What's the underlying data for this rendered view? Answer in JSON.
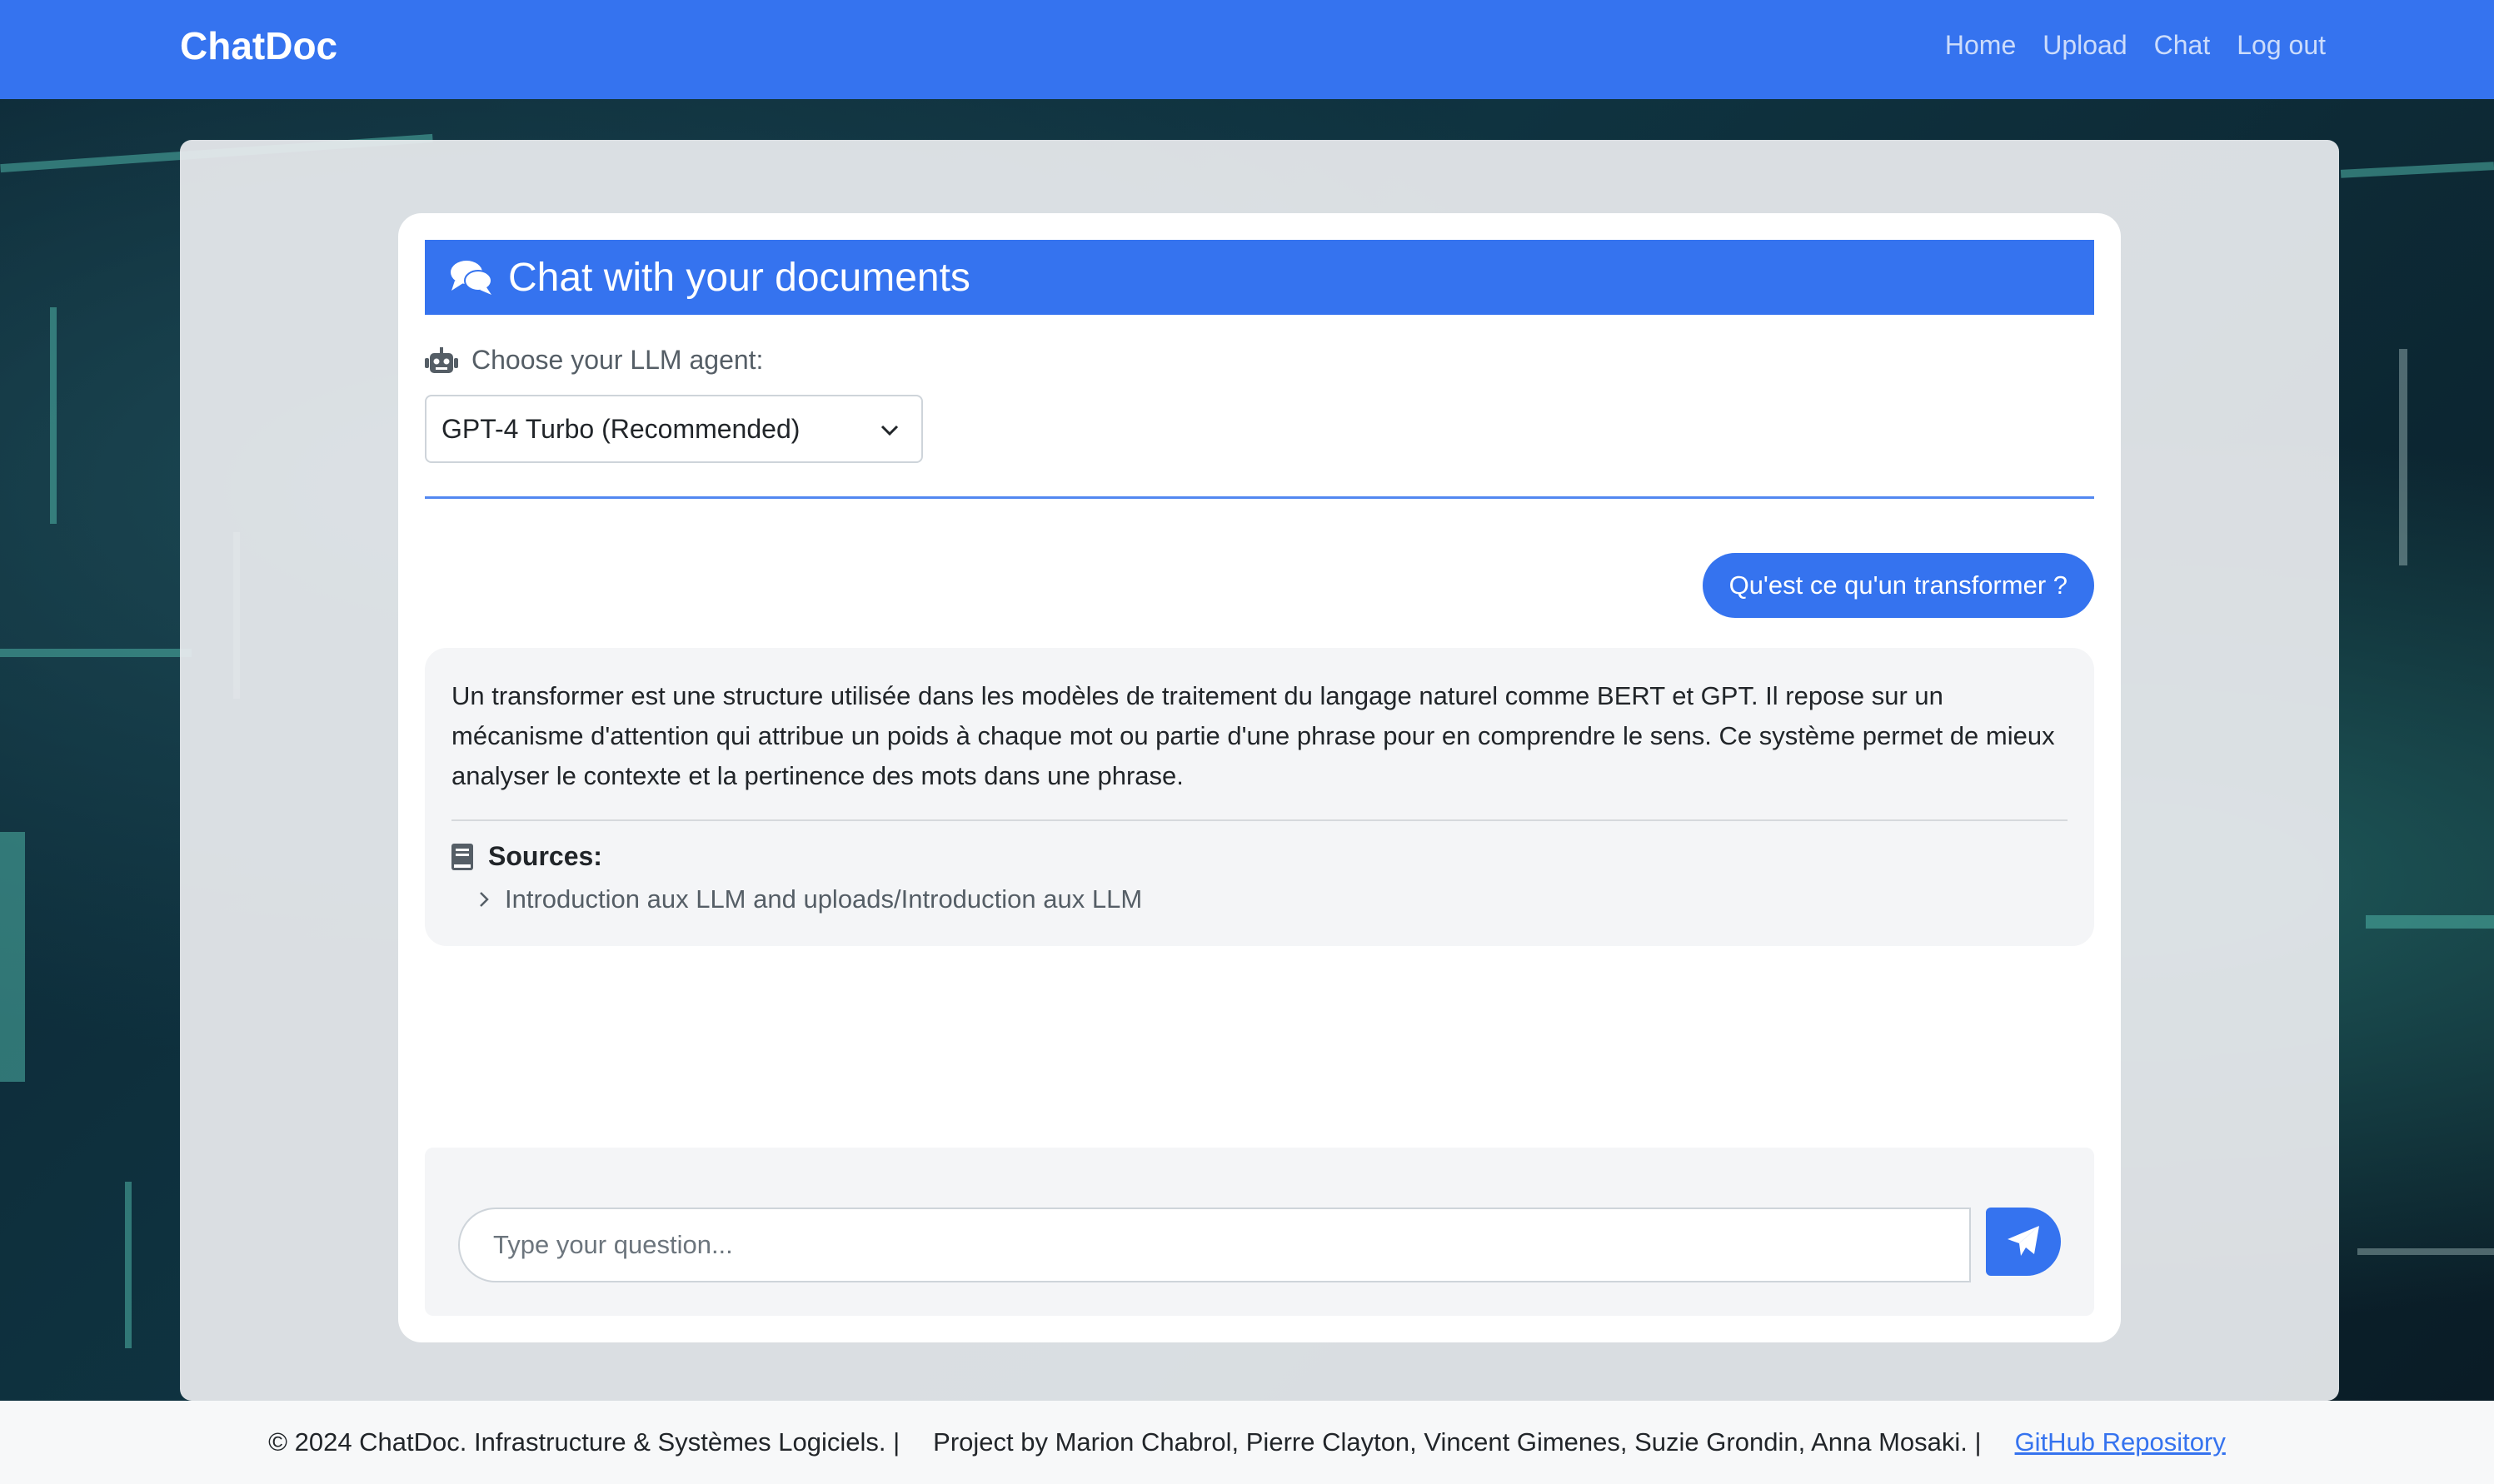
{
  "navbar": {
    "brand": "ChatDoc",
    "links": [
      "Home",
      "Upload",
      "Chat",
      "Log out"
    ]
  },
  "card": {
    "title": "Chat with your documents",
    "agent_label": "Choose your LLM agent:",
    "agent_selected": "GPT-4 Turbo (Recommended)"
  },
  "chat": {
    "user_message": "Qu'est ce qu'un transformer ?",
    "bot_message": "Un transformer est une structure utilisée dans les modèles de traitement du langage naturel comme BERT et GPT. Il repose sur un mécanisme d'attention qui attribue un poids à chaque mot ou partie d'une phrase pour en comprendre le sens. Ce système permet de mieux analyser le contexte et la pertinence des mots dans une phrase.",
    "sources_title": "Sources:",
    "sources": [
      "Introduction aux LLM and uploads/Introduction aux LLM"
    ]
  },
  "input": {
    "placeholder": "Type your question..."
  },
  "footer": {
    "copyright": "© 2024 ChatDoc. Infrastructure & Systèmes Logiciels. |",
    "project": "Project by Marion Chabrol, Pierre Clayton, Vincent Gimenes, Suzie Grondin, Anna Mosaki. |",
    "github_link": "GitHub Repository"
  },
  "colors": {
    "primary": "#3573ef",
    "footer_bg": "#f7f8f9"
  },
  "icons": {
    "header": "comments-icon",
    "agent": "robot-icon",
    "sources": "book-icon",
    "source_item": "chevron-right-icon",
    "send": "paper-plane-icon",
    "select": "chevron-down-icon"
  }
}
